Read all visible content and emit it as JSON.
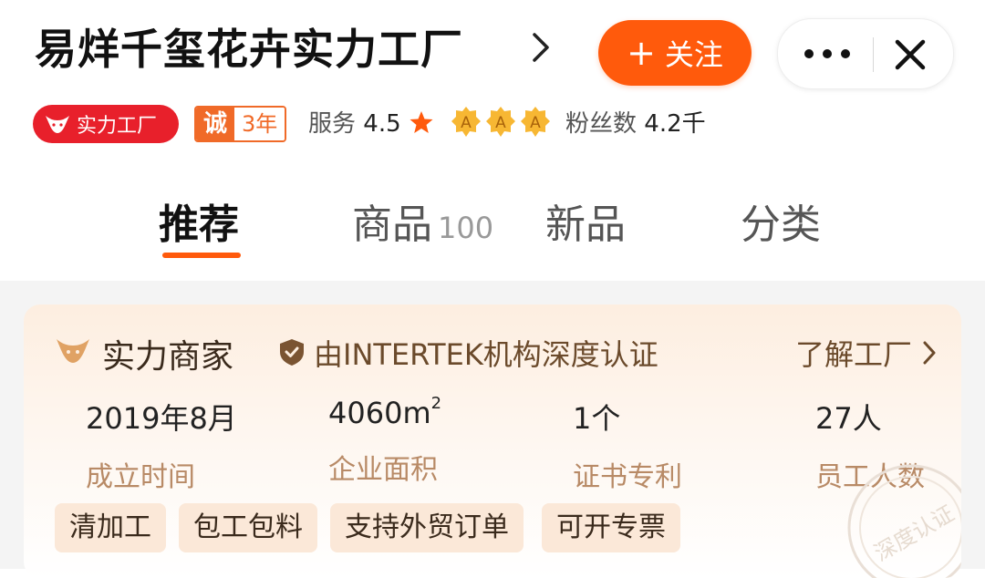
{
  "header": {
    "shop_name": "易烊千玺花卉实力工厂",
    "follow_label": "关注"
  },
  "badges": {
    "factory_label": "实力工厂",
    "cheng_label": "诚",
    "years_label": "3年",
    "service_label": "服务",
    "service_score": "4.5",
    "aaa_rating": [
      "A",
      "A",
      "A"
    ],
    "fans_label": "粉丝数",
    "fans_count": "4.2千"
  },
  "tabs": [
    {
      "label": "推荐",
      "active": true
    },
    {
      "label": "商品",
      "count": "100"
    },
    {
      "label": "新品"
    },
    {
      "label": "分类"
    }
  ],
  "merchant_card": {
    "title": "实力商家",
    "cert_text": "由INTERTEK机构深度认证",
    "learn_more": "了解工厂",
    "stats": [
      {
        "value": "2019年8月",
        "label": "成立时间"
      },
      {
        "value": "4060m",
        "sup": "2",
        "label": "企业面积"
      },
      {
        "value": "1个",
        "label": "证书专利"
      },
      {
        "value": "27人",
        "label": "员工人数"
      }
    ],
    "tags": [
      "清加工",
      "包工包料",
      "支持外贸订单",
      "可开专票"
    ],
    "stamp_text": "深度认证"
  },
  "colors": {
    "accent": "#ff5a0c",
    "factory_red": "#e8202b",
    "cheng_orange": "#f06a28",
    "card_brown": "#6b4a2b",
    "label_tan": "#b88a66"
  },
  "icons": [
    "chevron-right-icon",
    "plus-icon",
    "more-icon",
    "close-icon",
    "bull-icon",
    "star-icon",
    "aaa-badge-icon",
    "shield-check-icon",
    "certification-stamp"
  ]
}
